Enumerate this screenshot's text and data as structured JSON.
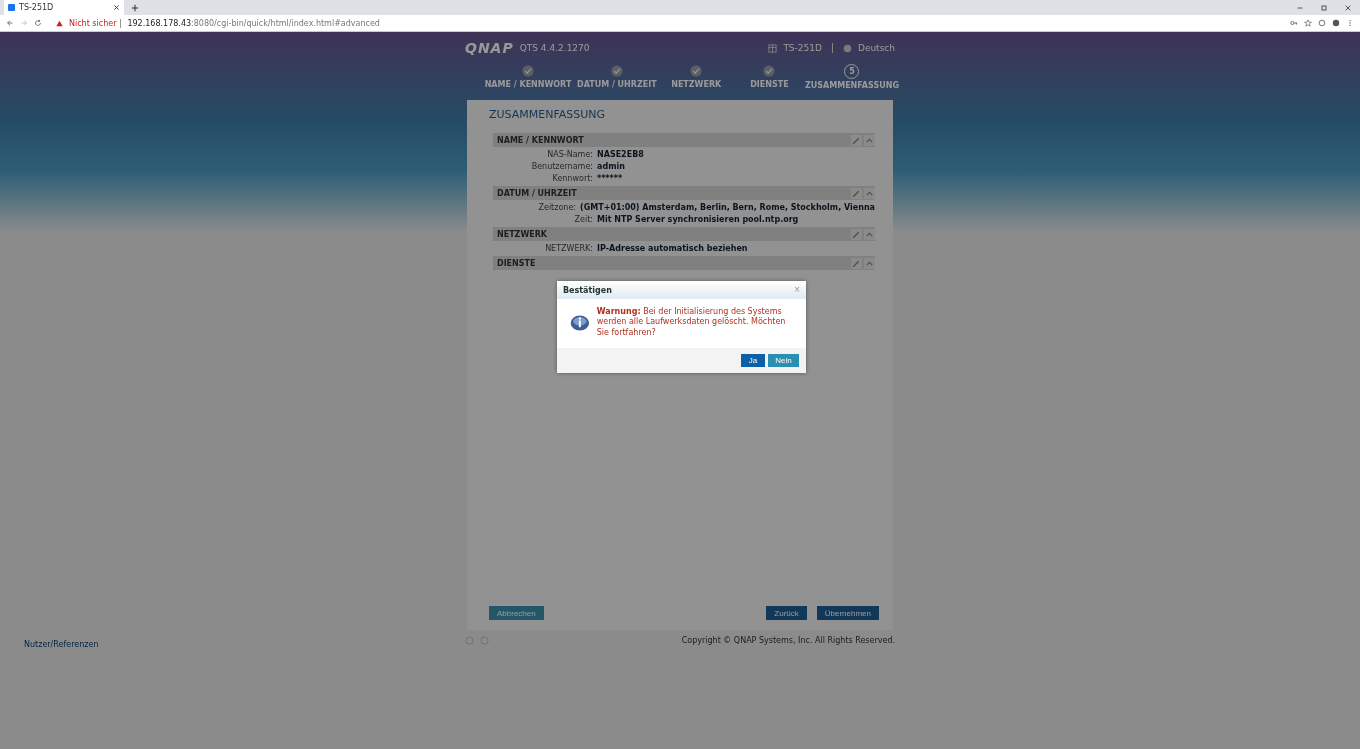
{
  "browser": {
    "tab": {
      "title": "TS-251D",
      "selected": true
    },
    "security": "Nicht sicher",
    "url_host": "192.168.178.43",
    "url_rest": ":8080/cgi-bin/quick/html/index.html#advanced"
  },
  "header": {
    "logo": "QNAP",
    "version": "QTS 4.4.2.1270",
    "device": "TS-251D",
    "language": "Deutsch"
  },
  "steps": [
    {
      "label": "NAME / KENNWORT",
      "kind": "done"
    },
    {
      "label": "DATUM / UHRZEIT",
      "kind": "done"
    },
    {
      "label": "NETZWERK",
      "kind": "done"
    },
    {
      "label": "DIENSTE",
      "kind": "done"
    },
    {
      "label": "ZUSAMMENFASSUNG",
      "kind": "current",
      "number": "5"
    }
  ],
  "panel": {
    "title": "ZUSAMMENFASSUNG",
    "sections": [
      {
        "title": "NAME / KENNWORT",
        "rows": [
          {
            "label": "NAS-Name:",
            "value": "NASE2EB8"
          },
          {
            "label": "Benutzername:",
            "value": "admin"
          },
          {
            "label": "Kennwort:",
            "value": "******"
          }
        ]
      },
      {
        "title": "DATUM / UHRZEIT",
        "rows": [
          {
            "label": "Zeitzone:",
            "value": "(GMT+01:00) Amsterdam, Berlin, Bern, Rome, Stockholm, Vienna"
          },
          {
            "label": "Zeit:",
            "value": "Mit NTP Server synchronisieren pool.ntp.org"
          }
        ]
      },
      {
        "title": "NETZWERK",
        "rows": [
          {
            "label": "NETZWERK:",
            "value": "IP-Adresse automatisch beziehen"
          }
        ]
      },
      {
        "title": "DIENSTE"
      }
    ],
    "buttons": {
      "cancel": "Abbrechen",
      "back": "Zurück",
      "apply": "Übernehmen"
    }
  },
  "footer": {
    "link": "Nutzer/Referenzen",
    "copyright": "Copyright © QNAP Systems, Inc. All Rights Reserved."
  },
  "dialog": {
    "title": "Bestätigen",
    "close": "×",
    "message": "**Warnung:** Bei der Initialisierung des Systems werden alle Laufwerksdaten gelöscht. Möchten Sie fortfahren?",
    "yes": "Ja",
    "no": "Nein"
  }
}
